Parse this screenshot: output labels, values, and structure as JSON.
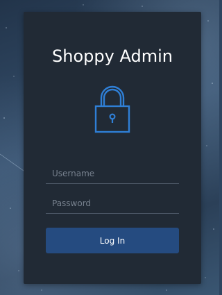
{
  "login_card": {
    "title": "Shoppy Admin",
    "lock_icon": "lock-icon",
    "username": {
      "placeholder": "Username",
      "value": ""
    },
    "password": {
      "placeholder": "Password",
      "value": ""
    },
    "login_label": "Log In"
  },
  "colors": {
    "card_background": "#212a35",
    "accent": "#2f7fd6",
    "button": "#254b80",
    "field_underline": "#4d5867"
  }
}
